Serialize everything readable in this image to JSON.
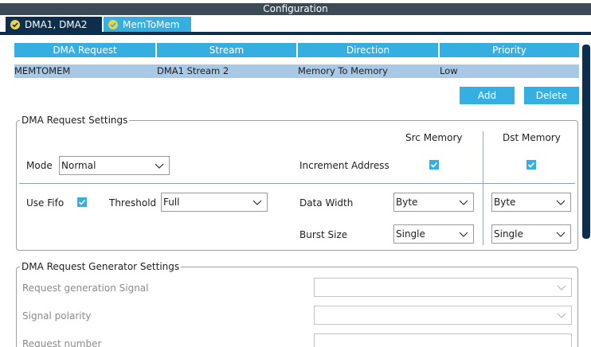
{
  "window": {
    "title": "Configuration"
  },
  "tabs": [
    {
      "label": "DMA1, DMA2",
      "icon": "check-circle-icon"
    },
    {
      "label": "MemToMem",
      "icon": "check-circle-icon"
    }
  ],
  "table": {
    "columns": [
      "DMA Request",
      "Stream",
      "Direction",
      "Priority"
    ],
    "rows": [
      [
        "MEMTOMEM",
        "DMA1 Stream 2",
        "Memory To Memory",
        "Low"
      ]
    ]
  },
  "buttons": {
    "add": "Add",
    "delete": "Delete"
  },
  "request_settings": {
    "title": "DMA Request Settings",
    "src_memory": "Src Memory",
    "dst_memory": "Dst Memory",
    "mode_label": "Mode",
    "mode_value": "Normal",
    "increment_address_label": "Increment Address",
    "src_increment": true,
    "dst_increment": true,
    "use_fifo_label": "Use Fifo",
    "use_fifo": true,
    "threshold_label": "Threshold",
    "threshold_value": "Full",
    "data_width_label": "Data Width",
    "src_data_width": "Byte",
    "dst_data_width": "Byte",
    "burst_size_label": "Burst Size",
    "src_burst_size": "Single",
    "dst_burst_size": "Single"
  },
  "generator_settings": {
    "title": "DMA Request Generator Settings",
    "request_generation_signal_label": "Request generation Signal",
    "request_generation_signal_value": "",
    "signal_polarity_label": "Signal polarity",
    "signal_polarity_value": "",
    "request_number_label": "Request number",
    "request_number_value": ""
  },
  "colors": {
    "accent": "#35aee1",
    "dark": "#0d2f4d",
    "titlebar": "#3c4a56",
    "selected_row": "#a9c8e6"
  }
}
